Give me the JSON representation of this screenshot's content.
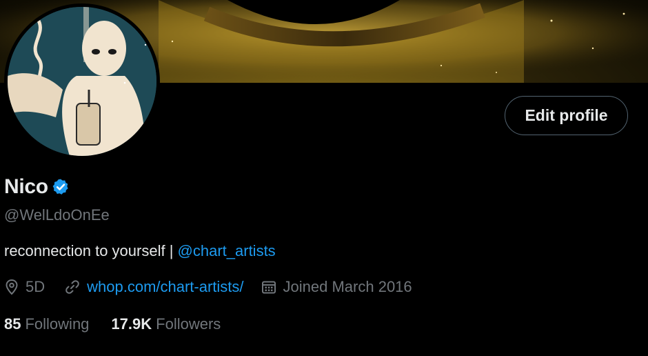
{
  "profile": {
    "name": "Nico",
    "handle": "@WelLdoOnEe",
    "bio_text": "reconnection to yourself | ",
    "bio_mention": "@chart_artists",
    "location": "5D",
    "website": "whop.com/chart-artists/",
    "joined": "Joined March 2016",
    "verified": true
  },
  "actions": {
    "edit_profile_label": "Edit profile"
  },
  "stats": {
    "following_count": "85",
    "following_label": "Following",
    "followers_count": "17.9K",
    "followers_label": "Followers"
  },
  "icons": {
    "verified": "verified-badge-icon",
    "location": "location-pin-icon",
    "website": "link-icon",
    "joined": "calendar-icon"
  },
  "colors": {
    "background": "#000000",
    "text_primary": "#e7e9ea",
    "text_secondary": "#71767b",
    "accent": "#1d9bf0",
    "button_border": "#536471"
  }
}
